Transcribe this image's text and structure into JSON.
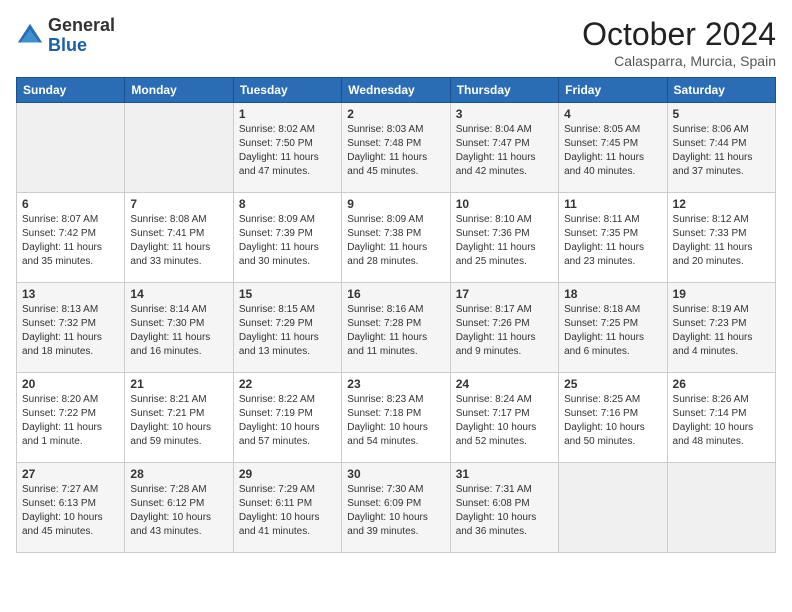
{
  "header": {
    "logo_line1": "General",
    "logo_line2": "Blue",
    "month_title": "October 2024",
    "location": "Calasparra, Murcia, Spain"
  },
  "weekdays": [
    "Sunday",
    "Monday",
    "Tuesday",
    "Wednesday",
    "Thursday",
    "Friday",
    "Saturday"
  ],
  "weeks": [
    [
      {
        "day": "",
        "info": ""
      },
      {
        "day": "",
        "info": ""
      },
      {
        "day": "1",
        "info": "Sunrise: 8:02 AM\nSunset: 7:50 PM\nDaylight: 11 hours and 47 minutes."
      },
      {
        "day": "2",
        "info": "Sunrise: 8:03 AM\nSunset: 7:48 PM\nDaylight: 11 hours and 45 minutes."
      },
      {
        "day": "3",
        "info": "Sunrise: 8:04 AM\nSunset: 7:47 PM\nDaylight: 11 hours and 42 minutes."
      },
      {
        "day": "4",
        "info": "Sunrise: 8:05 AM\nSunset: 7:45 PM\nDaylight: 11 hours and 40 minutes."
      },
      {
        "day": "5",
        "info": "Sunrise: 8:06 AM\nSunset: 7:44 PM\nDaylight: 11 hours and 37 minutes."
      }
    ],
    [
      {
        "day": "6",
        "info": "Sunrise: 8:07 AM\nSunset: 7:42 PM\nDaylight: 11 hours and 35 minutes."
      },
      {
        "day": "7",
        "info": "Sunrise: 8:08 AM\nSunset: 7:41 PM\nDaylight: 11 hours and 33 minutes."
      },
      {
        "day": "8",
        "info": "Sunrise: 8:09 AM\nSunset: 7:39 PM\nDaylight: 11 hours and 30 minutes."
      },
      {
        "day": "9",
        "info": "Sunrise: 8:09 AM\nSunset: 7:38 PM\nDaylight: 11 hours and 28 minutes."
      },
      {
        "day": "10",
        "info": "Sunrise: 8:10 AM\nSunset: 7:36 PM\nDaylight: 11 hours and 25 minutes."
      },
      {
        "day": "11",
        "info": "Sunrise: 8:11 AM\nSunset: 7:35 PM\nDaylight: 11 hours and 23 minutes."
      },
      {
        "day": "12",
        "info": "Sunrise: 8:12 AM\nSunset: 7:33 PM\nDaylight: 11 hours and 20 minutes."
      }
    ],
    [
      {
        "day": "13",
        "info": "Sunrise: 8:13 AM\nSunset: 7:32 PM\nDaylight: 11 hours and 18 minutes."
      },
      {
        "day": "14",
        "info": "Sunrise: 8:14 AM\nSunset: 7:30 PM\nDaylight: 11 hours and 16 minutes."
      },
      {
        "day": "15",
        "info": "Sunrise: 8:15 AM\nSunset: 7:29 PM\nDaylight: 11 hours and 13 minutes."
      },
      {
        "day": "16",
        "info": "Sunrise: 8:16 AM\nSunset: 7:28 PM\nDaylight: 11 hours and 11 minutes."
      },
      {
        "day": "17",
        "info": "Sunrise: 8:17 AM\nSunset: 7:26 PM\nDaylight: 11 hours and 9 minutes."
      },
      {
        "day": "18",
        "info": "Sunrise: 8:18 AM\nSunset: 7:25 PM\nDaylight: 11 hours and 6 minutes."
      },
      {
        "day": "19",
        "info": "Sunrise: 8:19 AM\nSunset: 7:23 PM\nDaylight: 11 hours and 4 minutes."
      }
    ],
    [
      {
        "day": "20",
        "info": "Sunrise: 8:20 AM\nSunset: 7:22 PM\nDaylight: 11 hours and 1 minute."
      },
      {
        "day": "21",
        "info": "Sunrise: 8:21 AM\nSunset: 7:21 PM\nDaylight: 10 hours and 59 minutes."
      },
      {
        "day": "22",
        "info": "Sunrise: 8:22 AM\nSunset: 7:19 PM\nDaylight: 10 hours and 57 minutes."
      },
      {
        "day": "23",
        "info": "Sunrise: 8:23 AM\nSunset: 7:18 PM\nDaylight: 10 hours and 54 minutes."
      },
      {
        "day": "24",
        "info": "Sunrise: 8:24 AM\nSunset: 7:17 PM\nDaylight: 10 hours and 52 minutes."
      },
      {
        "day": "25",
        "info": "Sunrise: 8:25 AM\nSunset: 7:16 PM\nDaylight: 10 hours and 50 minutes."
      },
      {
        "day": "26",
        "info": "Sunrise: 8:26 AM\nSunset: 7:14 PM\nDaylight: 10 hours and 48 minutes."
      }
    ],
    [
      {
        "day": "27",
        "info": "Sunrise: 7:27 AM\nSunset: 6:13 PM\nDaylight: 10 hours and 45 minutes."
      },
      {
        "day": "28",
        "info": "Sunrise: 7:28 AM\nSunset: 6:12 PM\nDaylight: 10 hours and 43 minutes."
      },
      {
        "day": "29",
        "info": "Sunrise: 7:29 AM\nSunset: 6:11 PM\nDaylight: 10 hours and 41 minutes."
      },
      {
        "day": "30",
        "info": "Sunrise: 7:30 AM\nSunset: 6:09 PM\nDaylight: 10 hours and 39 minutes."
      },
      {
        "day": "31",
        "info": "Sunrise: 7:31 AM\nSunset: 6:08 PM\nDaylight: 10 hours and 36 minutes."
      },
      {
        "day": "",
        "info": ""
      },
      {
        "day": "",
        "info": ""
      }
    ]
  ]
}
